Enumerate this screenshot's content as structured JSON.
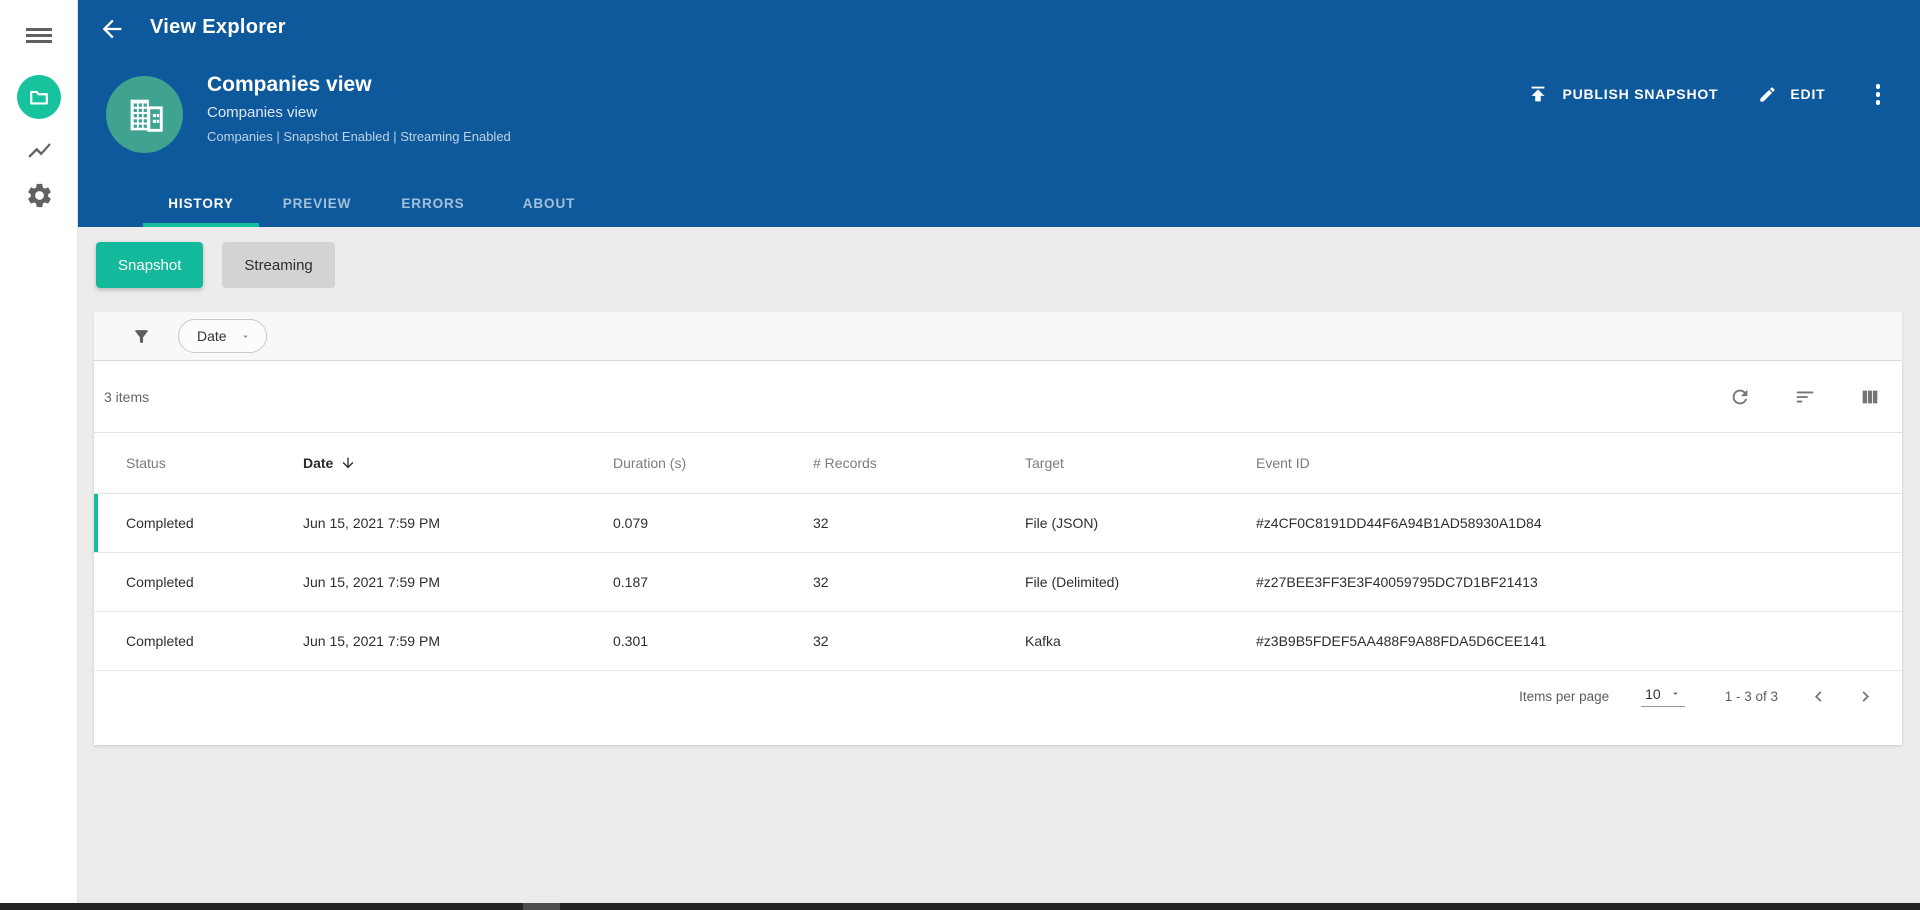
{
  "window": {
    "title": "View Explorer"
  },
  "sidebar": {
    "items": [
      {
        "name": "menu",
        "icon": "hamburger-icon"
      },
      {
        "name": "views",
        "icon": "folder-icon"
      },
      {
        "name": "activity",
        "icon": "line-chart-icon"
      },
      {
        "name": "settings",
        "icon": "gear-icon"
      }
    ]
  },
  "header": {
    "entity": {
      "title": "Companies view",
      "subtitle": "Companies view",
      "meta": "Companies | Snapshot Enabled | Streaming Enabled"
    },
    "actions": {
      "publish_label": "PUBLISH SNAPSHOT",
      "edit_label": "EDIT"
    },
    "tabs": [
      {
        "label": "HISTORY",
        "active": true
      },
      {
        "label": "PREVIEW",
        "active": false
      },
      {
        "label": "ERRORS",
        "active": false
      },
      {
        "label": "ABOUT",
        "active": false
      }
    ]
  },
  "toggles": {
    "snapshot_label": "Snapshot",
    "streaming_label": "Streaming",
    "active": "Snapshot"
  },
  "filter": {
    "dropdown_value": "Date"
  },
  "table": {
    "items_count": "3 items",
    "columns": [
      {
        "label": "Status"
      },
      {
        "label": "Date",
        "sorted": "desc"
      },
      {
        "label": "Duration (s)"
      },
      {
        "label": "# Records"
      },
      {
        "label": "Target"
      },
      {
        "label": "Event ID"
      }
    ],
    "rows": [
      {
        "status": "Completed",
        "date": "Jun 15, 2021 7:59 PM",
        "duration": "0.079",
        "records": "32",
        "target": "File (JSON)",
        "event_id": "#z4CF0C8191DD44F6A94B1AD58930A1D84",
        "selected": true
      },
      {
        "status": "Completed",
        "date": "Jun 15, 2021 7:59 PM",
        "duration": "0.187",
        "records": "32",
        "target": "File (Delimited)",
        "event_id": "#z27BEE3FF3E3F40059795DC7D1BF21413",
        "selected": false
      },
      {
        "status": "Completed",
        "date": "Jun 15, 2021 7:59 PM",
        "duration": "0.301",
        "records": "32",
        "target": "Kafka",
        "event_id": "#z3B9B5FDEF5AA488F9A88FDA5D6CEE141",
        "selected": false
      }
    ],
    "pagination": {
      "items_per_page_label": "Items per page",
      "page_size": "10",
      "range": "1 - 3 of 3"
    }
  },
  "colors": {
    "appbar_blue": "#0d599c",
    "accent_teal": "#14bd9b",
    "snapshot_button_teal": "#12b99a",
    "avatar_green": "#3fa390",
    "sidebar_badge_green": "#16c39c",
    "page_background": "#ececec"
  }
}
